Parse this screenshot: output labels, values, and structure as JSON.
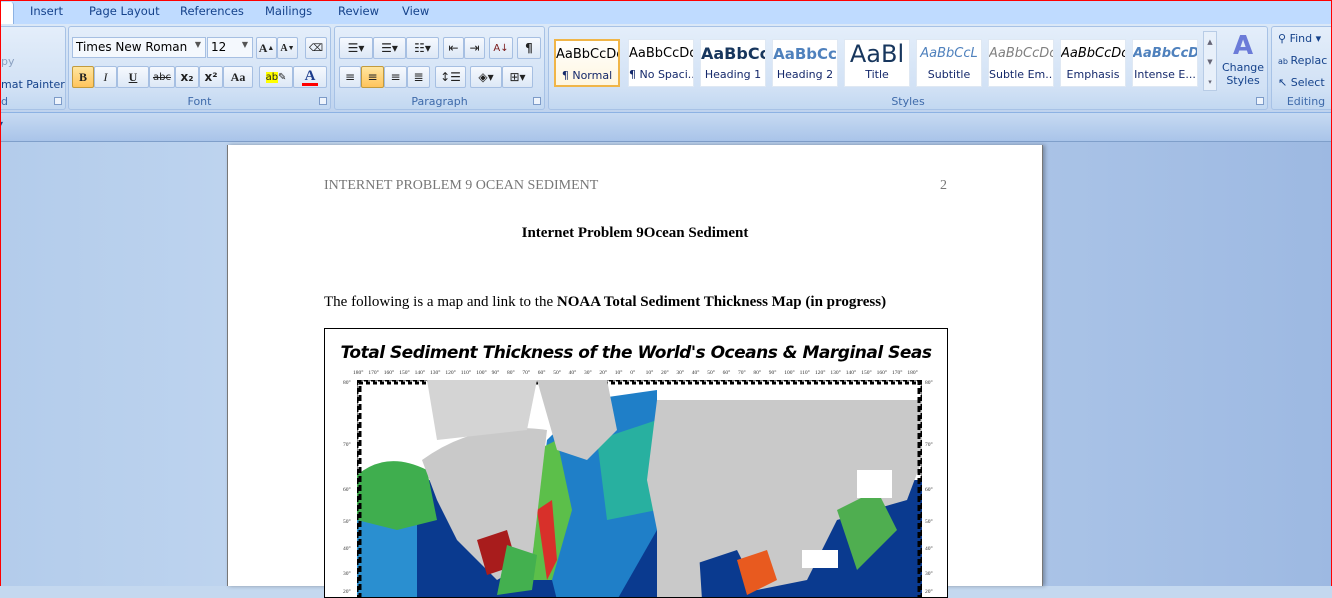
{
  "tabs": [
    "Insert",
    "Page Layout",
    "References",
    "Mailings",
    "Review",
    "View"
  ],
  "clipboard": {
    "copy": "py",
    "format_painter": "mat Painter",
    "label": "d"
  },
  "font": {
    "name": "Times New Roman",
    "size": "12",
    "label": "Font",
    "bold": "B",
    "italic": "I",
    "underline": "U",
    "strike": "abc",
    "sub": "x₂",
    "sup": "x²",
    "case": "Aa",
    "grow": "A",
    "shrink": "A",
    "color_accent": "#ff0000"
  },
  "paragraph": {
    "label": "Paragraph",
    "pilcrow": "¶",
    "sort": "A↓"
  },
  "styles": {
    "label": "Styles",
    "items": [
      {
        "preview": "AaBbCcDc",
        "name": "¶ Normal"
      },
      {
        "preview": "AaBbCcDc",
        "name": "¶ No Spaci..."
      },
      {
        "preview": "AaBbCc",
        "name": "Heading 1"
      },
      {
        "preview": "AaBbCc",
        "name": "Heading 2"
      },
      {
        "preview": "AaBl",
        "name": "Title"
      },
      {
        "preview": "AaBbCcL",
        "name": "Subtitle"
      },
      {
        "preview": "AaBbCcDc",
        "name": "Subtle Em..."
      },
      {
        "preview": "AaBbCcDc",
        "name": "Emphasis"
      },
      {
        "preview": "AaBbCcDc",
        "name": "Intense E..."
      }
    ],
    "change_styles": "Change Styles"
  },
  "editing": {
    "label": "Editing",
    "find": "Find",
    "replace": "Replac",
    "select": "Select"
  },
  "document": {
    "header_text": "INTERNET PROBLEM 9 OCEAN SEDIMENT",
    "page_number": "2",
    "title": "Internet Problem 9Ocean Sediment",
    "body_prefix": "The following is a map and link to the ",
    "body_bold": "NOAA Total Sediment Thickness Map (in progress)",
    "figure": {
      "title": "Total Sediment Thickness of the World's Oceans & Marginal Seas",
      "longitudes": [
        "180°",
        "170°",
        "160°",
        "150°",
        "140°",
        "130°",
        "120°",
        "110°",
        "100°",
        "90°",
        "80°",
        "70°",
        "60°",
        "50°",
        "40°",
        "30°",
        "20°",
        "10°",
        "0°",
        "10°",
        "20°",
        "30°",
        "40°",
        "50°",
        "60°",
        "70°",
        "80°",
        "90°",
        "100°",
        "110°",
        "120°",
        "130°",
        "140°",
        "150°",
        "160°",
        "170°",
        "180°"
      ],
      "latitudes": [
        "80°",
        "70°",
        "60°",
        "50°",
        "40°",
        "30°",
        "20°",
        "10°"
      ]
    }
  }
}
